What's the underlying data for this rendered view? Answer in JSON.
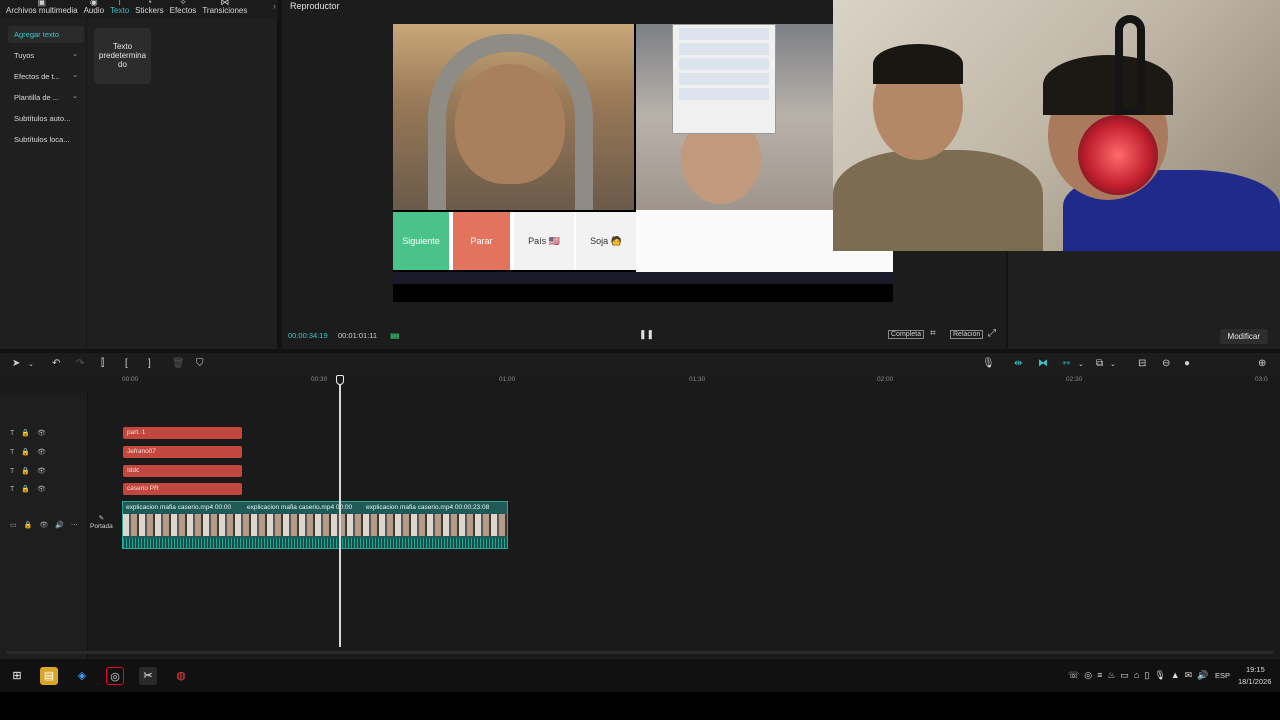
{
  "top_tabs": [
    {
      "label": "Archivos multimedia",
      "icon": "media-icon"
    },
    {
      "label": "Audio",
      "icon": "audio-icon"
    },
    {
      "label": "Texto",
      "icon": "text-icon"
    },
    {
      "label": "Stickers",
      "icon": "sticker-icon"
    },
    {
      "label": "Efectos",
      "icon": "effects-icon"
    },
    {
      "label": "Transiciones",
      "icon": "transitions-icon"
    }
  ],
  "left_menu": [
    {
      "label": "Agregar texto"
    },
    {
      "label": "Tuyos"
    },
    {
      "label": "Efectos de t..."
    },
    {
      "label": "Plantilla de ..."
    },
    {
      "label": "Subtítulos auto..."
    },
    {
      "label": "Subtítulos loca..."
    }
  ],
  "text_card": "Texto predetermina do",
  "player": {
    "title": "Reproductor",
    "time_current": "00:00:34:19",
    "time_total": "00:01:01:11",
    "completa": "Completa",
    "relacion": "Relación",
    "buttons": {
      "next": "Siguiente",
      "stop": "Parar",
      "country": "País 🇺🇸",
      "soy": "Soja 🧑"
    }
  },
  "modify_label": "Modificar",
  "ruler": [
    "00:00",
    "00:30",
    "01:00",
    "01:30",
    "02:00",
    "02:30",
    "03:0"
  ],
  "text_tracks": [
    "part. 1",
    "Jefrano07",
    "Iddc",
    "caserio PR"
  ],
  "video_clips": [
    {
      "label": "explicacion mafia caserio.mp4  00:00"
    },
    {
      "label": "explicacion mafia caserio.mp4  00:00"
    },
    {
      "label": "explicacion mafia caserio.mp4  00:00:23:08"
    }
  ],
  "cover_label": "Portada",
  "taskbar": {
    "lang": "ESP",
    "time": "19:15",
    "date": "18/1/2026"
  }
}
